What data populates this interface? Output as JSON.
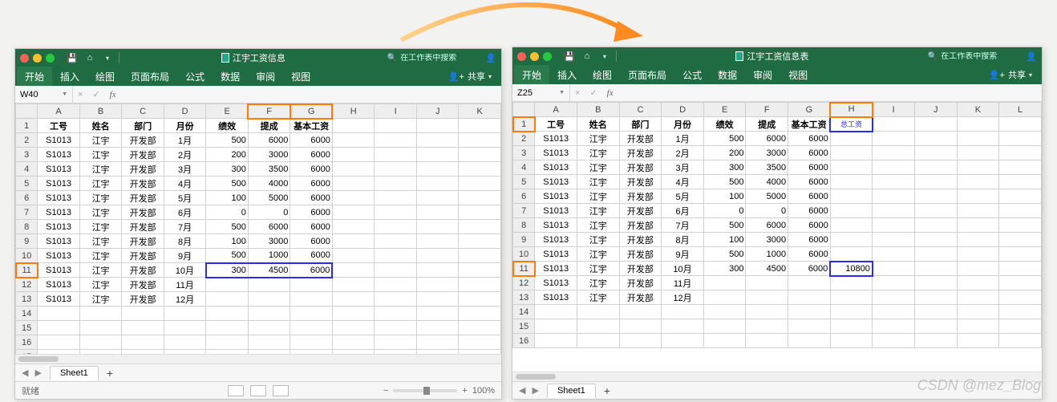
{
  "left": {
    "title": "江宇工资信息",
    "search_placeholder": "在工作表中搜索",
    "tabs": [
      "开始",
      "插入",
      "绘图",
      "页面布局",
      "公式",
      "数据",
      "审阅",
      "视图"
    ],
    "share_label": "共享",
    "namebox": "W40",
    "fx_label": "fx",
    "sheet_tab": "Sheet1",
    "status_text": "就绪",
    "zoom_text": "100%",
    "cols": [
      "A",
      "B",
      "C",
      "D",
      "E",
      "F",
      "G",
      "H",
      "I",
      "J",
      "K"
    ],
    "header_row": [
      "工号",
      "姓名",
      "部门",
      "月份",
      "绩效",
      "提成",
      "基本工资"
    ],
    "highlight_col_headers": [
      "F",
      "G"
    ],
    "highlight_row_index": 11,
    "blue_range_row": 11,
    "blue_range_cols": [
      "E",
      "F",
      "G"
    ],
    "rows": [
      {
        "a": "S1013",
        "b": "江宇",
        "c": "开发部",
        "d": "1月",
        "e": "500",
        "f": "6000",
        "g": "6000"
      },
      {
        "a": "S1013",
        "b": "江宇",
        "c": "开发部",
        "d": "2月",
        "e": "200",
        "f": "3000",
        "g": "6000"
      },
      {
        "a": "S1013",
        "b": "江宇",
        "c": "开发部",
        "d": "3月",
        "e": "300",
        "f": "3500",
        "g": "6000"
      },
      {
        "a": "S1013",
        "b": "江宇",
        "c": "开发部",
        "d": "4月",
        "e": "500",
        "f": "4000",
        "g": "6000"
      },
      {
        "a": "S1013",
        "b": "江宇",
        "c": "开发部",
        "d": "5月",
        "e": "100",
        "f": "5000",
        "g": "6000"
      },
      {
        "a": "S1013",
        "b": "江宇",
        "c": "开发部",
        "d": "6月",
        "e": "0",
        "f": "0",
        "g": "6000"
      },
      {
        "a": "S1013",
        "b": "江宇",
        "c": "开发部",
        "d": "7月",
        "e": "500",
        "f": "6000",
        "g": "6000"
      },
      {
        "a": "S1013",
        "b": "江宇",
        "c": "开发部",
        "d": "8月",
        "e": "100",
        "f": "3000",
        "g": "6000"
      },
      {
        "a": "S1013",
        "b": "江宇",
        "c": "开发部",
        "d": "9月",
        "e": "500",
        "f": "1000",
        "g": "6000"
      },
      {
        "a": "S1013",
        "b": "江宇",
        "c": "开发部",
        "d": "10月",
        "e": "300",
        "f": "4500",
        "g": "6000"
      },
      {
        "a": "S1013",
        "b": "江宇",
        "c": "开发部",
        "d": "11月",
        "e": "",
        "f": "",
        "g": ""
      },
      {
        "a": "S1013",
        "b": "江宇",
        "c": "开发部",
        "d": "12月",
        "e": "",
        "f": "",
        "g": ""
      }
    ]
  },
  "right": {
    "title": "江宇工资信息表",
    "search_placeholder": "在工作表中搜索",
    "tabs": [
      "开始",
      "插入",
      "绘图",
      "页面布局",
      "公式",
      "数据",
      "审阅",
      "视图"
    ],
    "share_label": "共享",
    "namebox": "Z25",
    "fx_label": "fx",
    "sheet_tab": "Sheet1",
    "cols": [
      "A",
      "B",
      "C",
      "D",
      "E",
      "F",
      "G",
      "H",
      "I",
      "J",
      "K",
      "L"
    ],
    "header_row": [
      "工号",
      "姓名",
      "部门",
      "月份",
      "绩效",
      "提成",
      "基本工资",
      "总工资"
    ],
    "new_col_header": "H",
    "highlight_row_header": 1,
    "blue_cell_header_col": "H",
    "highlight_row_index": 11,
    "blue_cell_value_row": 11,
    "h_value_row11": "10800",
    "rows": [
      {
        "a": "S1013",
        "b": "江宇",
        "c": "开发部",
        "d": "1月",
        "e": "500",
        "f": "6000",
        "g": "6000",
        "h": ""
      },
      {
        "a": "S1013",
        "b": "江宇",
        "c": "开发部",
        "d": "2月",
        "e": "200",
        "f": "3000",
        "g": "6000",
        "h": ""
      },
      {
        "a": "S1013",
        "b": "江宇",
        "c": "开发部",
        "d": "3月",
        "e": "300",
        "f": "3500",
        "g": "6000",
        "h": ""
      },
      {
        "a": "S1013",
        "b": "江宇",
        "c": "开发部",
        "d": "4月",
        "e": "500",
        "f": "4000",
        "g": "6000",
        "h": ""
      },
      {
        "a": "S1013",
        "b": "江宇",
        "c": "开发部",
        "d": "5月",
        "e": "100",
        "f": "5000",
        "g": "6000",
        "h": ""
      },
      {
        "a": "S1013",
        "b": "江宇",
        "c": "开发部",
        "d": "6月",
        "e": "0",
        "f": "0",
        "g": "6000",
        "h": ""
      },
      {
        "a": "S1013",
        "b": "江宇",
        "c": "开发部",
        "d": "7月",
        "e": "500",
        "f": "6000",
        "g": "6000",
        "h": ""
      },
      {
        "a": "S1013",
        "b": "江宇",
        "c": "开发部",
        "d": "8月",
        "e": "100",
        "f": "3000",
        "g": "6000",
        "h": ""
      },
      {
        "a": "S1013",
        "b": "江宇",
        "c": "开发部",
        "d": "9月",
        "e": "500",
        "f": "1000",
        "g": "6000",
        "h": ""
      },
      {
        "a": "S1013",
        "b": "江宇",
        "c": "开发部",
        "d": "10月",
        "e": "300",
        "f": "4500",
        "g": "6000",
        "h": "10800"
      },
      {
        "a": "S1013",
        "b": "江宇",
        "c": "开发部",
        "d": "11月",
        "e": "",
        "f": "",
        "g": "",
        "h": ""
      },
      {
        "a": "S1013",
        "b": "江宇",
        "c": "开发部",
        "d": "12月",
        "e": "",
        "f": "",
        "g": "",
        "h": ""
      }
    ]
  },
  "watermark": "CSDN @mez_Blog"
}
